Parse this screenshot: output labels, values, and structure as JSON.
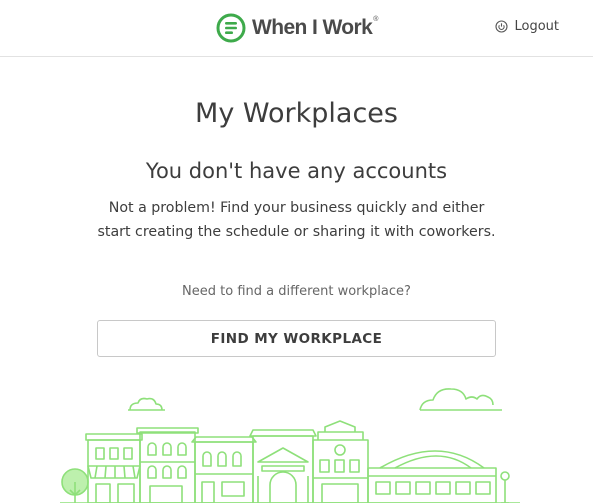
{
  "header": {
    "logo_text": "When I Work",
    "logo_mark": "®",
    "logout_label": "Logout",
    "brand_color": "#3eaa4b"
  },
  "main": {
    "title": "My Workplaces",
    "empty_heading": "You don't have any accounts",
    "empty_description": "Not a problem! Find your business quickly and either start creating the schedule or sharing it with coworkers.",
    "hint": "Need to find a different workplace?",
    "find_button_label": "FIND MY WORKPLACE"
  },
  "icons": {
    "logo": "when-i-work-logo-icon",
    "logout": "power-icon"
  },
  "illustration": {
    "name": "town-illustration",
    "color": "#8ee07a"
  }
}
